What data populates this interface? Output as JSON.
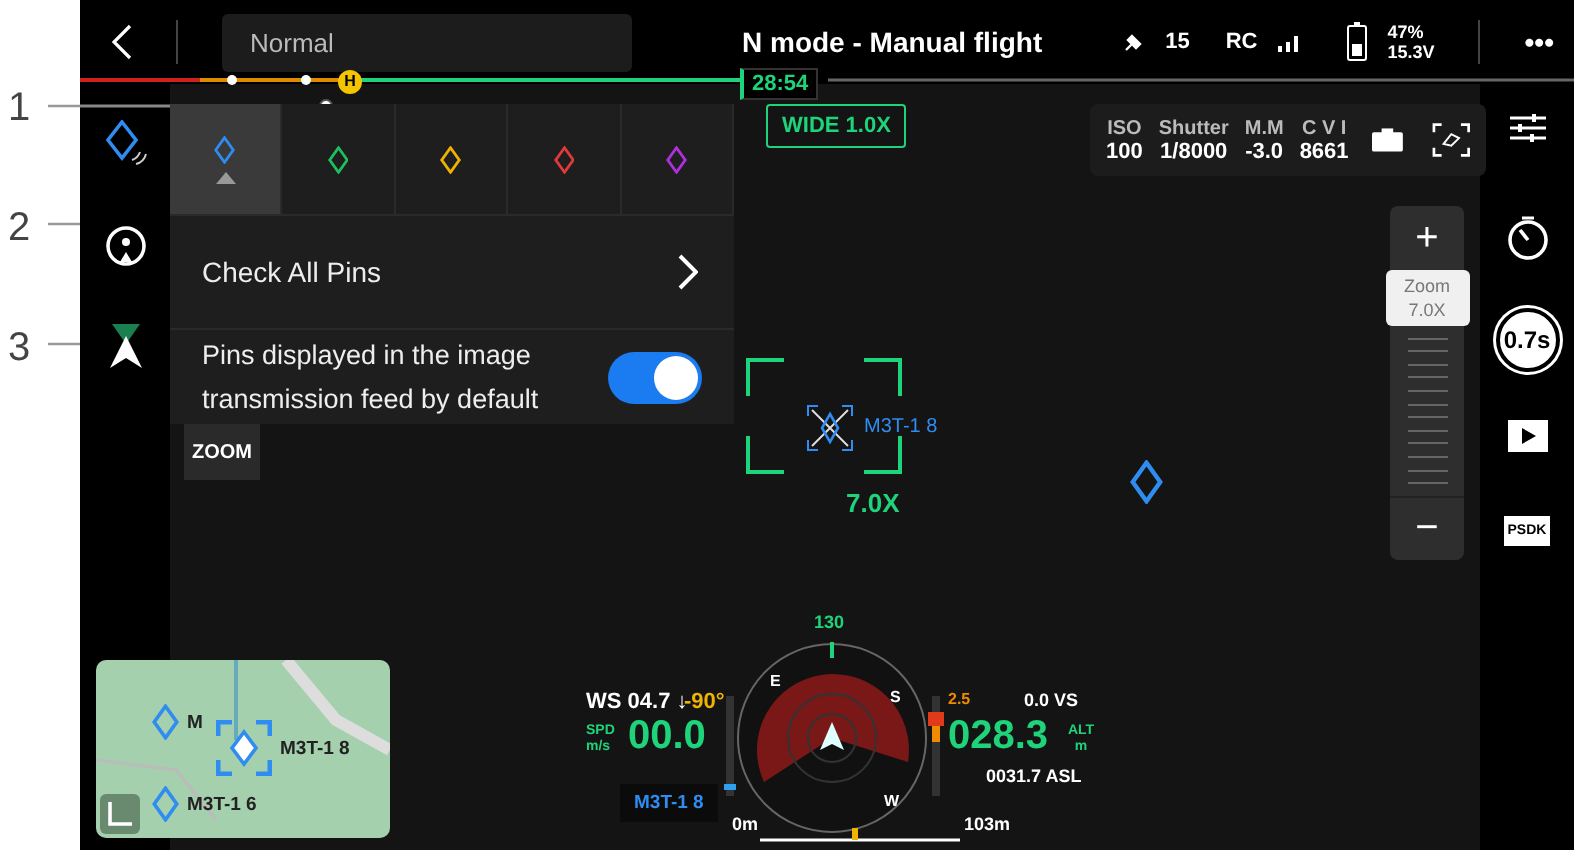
{
  "top_bar": {
    "flight_mode": "Normal",
    "title": "N mode - Manual flight",
    "satellites": "15",
    "rc_label": "RC",
    "battery_percent": "47%",
    "battery_voltage": "15.3V",
    "menu": "•••"
  },
  "timeline": {
    "home_mark": "H",
    "time": "28:54"
  },
  "lens_badge": "WIDE 1.0X",
  "camera_params": [
    {
      "label": "ISO",
      "value": "100"
    },
    {
      "label": "Shutter",
      "value": "1/8000"
    },
    {
      "label": "M.M",
      "value": "-3.0"
    },
    {
      "label": "C V I",
      "value": "8661"
    }
  ],
  "pin_panel": {
    "colors": [
      {
        "color": "#2f8cf0",
        "selected": true
      },
      {
        "color": "#1fbf60",
        "selected": false
      },
      {
        "color": "#f0b400",
        "selected": false
      },
      {
        "color": "#e03a3a",
        "selected": false
      },
      {
        "color": "#b030e0",
        "selected": false
      }
    ],
    "check_all_label": "Check All Pins",
    "toggle_label": "Pins displayed in the image transmission feed by default",
    "toggle_on": true
  },
  "callouts": [
    "1",
    "2",
    "3"
  ],
  "zoom_button": "ZOOM",
  "target": {
    "label": "M3T-1 8",
    "zoom": "7.0X"
  },
  "zoom_control": {
    "plus": "+",
    "label": "Zoom",
    "value": "7.0X",
    "minus": "−"
  },
  "shutter_time": "0.7s",
  "psdk": "PSDK",
  "hud": {
    "wind": "WS 04.7 ↓",
    "wind_dir": "-90°",
    "spd_unit": "SPD",
    "spd_unit2": "m/s",
    "speed": "00.0",
    "heading": "130",
    "compass": [
      "E",
      "S",
      "W"
    ],
    "vs_scale": "2.5",
    "vs": "0.0 VS",
    "altitude": "028.3",
    "alt_unit": "ALT",
    "alt_unit2": "m",
    "asl": "0031.7 ASL",
    "pin_tag": "M3T-1 8",
    "distance_start": "0m",
    "distance_end": "103m"
  },
  "map": {
    "pins": [
      {
        "label": "M"
      },
      {
        "label": "M3T-1 8",
        "selected": true
      },
      {
        "label": "M3T-1 6"
      }
    ]
  }
}
